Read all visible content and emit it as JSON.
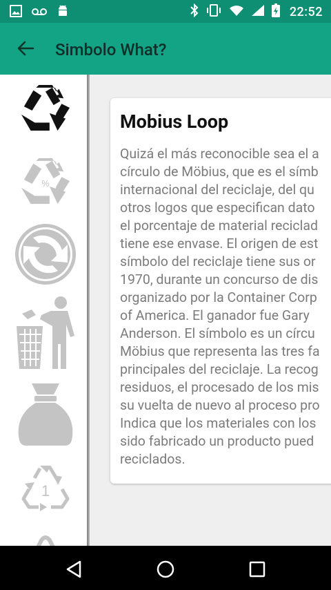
{
  "status_bar": {
    "time": "22:52",
    "left_icons": [
      "image-icon",
      "voicemail-icon",
      "android-icon"
    ],
    "right_icons": [
      "bluetooth-icon",
      "vibrate-icon",
      "wifi-icon",
      "signal-icon",
      "battery-icon"
    ]
  },
  "app_bar": {
    "title": "Simbolo What?",
    "back_icon": "arrow-back-icon"
  },
  "sidebar": {
    "items": [
      {
        "icon": "recycle-black-icon"
      },
      {
        "icon": "recycle-percent-icon"
      },
      {
        "icon": "green-dot-icon"
      },
      {
        "icon": "tidyman-icon"
      },
      {
        "icon": "garbage-bag-icon"
      },
      {
        "icon": "resin-code-1-icon"
      },
      {
        "icon": "partial-icon"
      }
    ]
  },
  "card": {
    "title": "Mobius Loop",
    "text": "Quizá el más reconocible sea el a\ncírculo de Möbius, que es el símb\ninternacional del reciclaje, del qu\notros logos que especifican dato\nel porcentaje de material reciclad\ntiene ese envase. El origen de est\nsímbolo del reciclaje tiene sus or\n1970, durante un concurso de dis\norganizado por la Container Corp\nof America. El ganador fue Gary\nAnderson. El símbolo es un círcu\nMöbius que representa las tres fa\nprincipales del reciclaje. La recog\nresiduos, el procesado de los mis\nsu vuelta de nuevo al proceso pro\nIndica que los materiales con los\nsido fabricado un producto pued\nreciclados."
  },
  "nav_bar": {
    "buttons": [
      "back-triangle-icon",
      "home-circle-icon",
      "recents-square-icon"
    ]
  },
  "colors": {
    "status_bar": "#0e8f74",
    "app_bar": "#13a486",
    "title_text": "#0f2e28",
    "icon_gray": "#c4c4c4",
    "icon_black": "#111111",
    "main_bg": "#efefef"
  }
}
